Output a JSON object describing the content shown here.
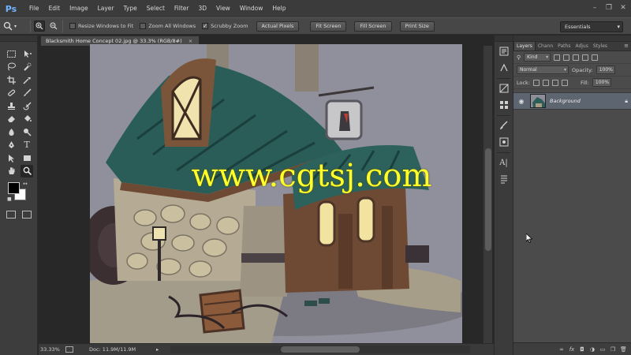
{
  "app": {
    "logo": "Ps"
  },
  "menu": [
    "File",
    "Edit",
    "Image",
    "Layer",
    "Type",
    "Select",
    "Filter",
    "3D",
    "View",
    "Window",
    "Help"
  ],
  "window_controls": {
    "minimize": "–",
    "restore": "❐",
    "close": "✕"
  },
  "options_bar": {
    "resize_windows": {
      "label": "Resize Windows to Fit",
      "checked": false
    },
    "zoom_all_windows": {
      "label": "Zoom All Windows",
      "checked": false
    },
    "scrubby_zoom": {
      "label": "Scrubby Zoom",
      "checked": true
    },
    "buttons": [
      "Actual Pixels",
      "Fit Screen",
      "Fill Screen",
      "Print Size"
    ],
    "workspace": "Essentials"
  },
  "document": {
    "tab_title": "Blacksmith Home Concept 02.jpg @ 33.3% (RGB/8#)",
    "tab_close": "×",
    "zoom": "33.33%",
    "doc_size": "Doc: 11.9M/11.9M",
    "status_arrow": "▸"
  },
  "watermark": "www.cgtsj.com",
  "layers_panel": {
    "tabs": [
      "Layers",
      "Chann",
      "Paths",
      "Adjus",
      "Styles"
    ],
    "kind_filter": "Kind",
    "blend_mode": "Normal",
    "opacity_label": "Opacity:",
    "opacity_value": "100%",
    "lock_label": "Lock:",
    "fill_label": "Fill:",
    "fill_value": "100%",
    "layer_name": "Background"
  },
  "colors": {
    "accent": "#6fb6ff",
    "watermark": "#ffff2a",
    "canvas_bg": "#8e8f9a",
    "panel_bg": "#4b4b4b"
  }
}
